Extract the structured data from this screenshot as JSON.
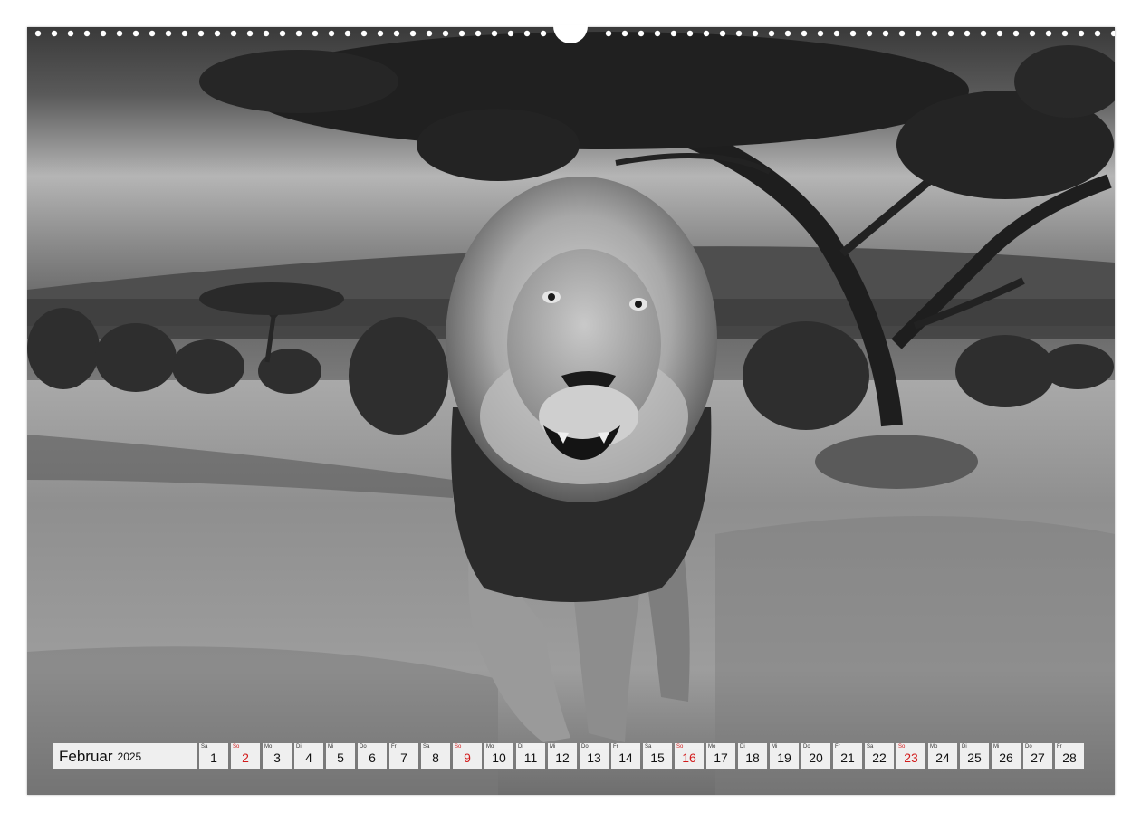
{
  "calendar": {
    "month": "Februar",
    "year": "2025",
    "days": [
      {
        "wd": "Sa",
        "num": "1",
        "sunday": false
      },
      {
        "wd": "So",
        "num": "2",
        "sunday": true
      },
      {
        "wd": "Mo",
        "num": "3",
        "sunday": false
      },
      {
        "wd": "Di",
        "num": "4",
        "sunday": false
      },
      {
        "wd": "Mi",
        "num": "5",
        "sunday": false
      },
      {
        "wd": "Do",
        "num": "6",
        "sunday": false
      },
      {
        "wd": "Fr",
        "num": "7",
        "sunday": false
      },
      {
        "wd": "Sa",
        "num": "8",
        "sunday": false
      },
      {
        "wd": "So",
        "num": "9",
        "sunday": true
      },
      {
        "wd": "Mo",
        "num": "10",
        "sunday": false
      },
      {
        "wd": "Di",
        "num": "11",
        "sunday": false
      },
      {
        "wd": "Mi",
        "num": "12",
        "sunday": false
      },
      {
        "wd": "Do",
        "num": "13",
        "sunday": false
      },
      {
        "wd": "Fr",
        "num": "14",
        "sunday": false
      },
      {
        "wd": "Sa",
        "num": "15",
        "sunday": false
      },
      {
        "wd": "So",
        "num": "16",
        "sunday": true
      },
      {
        "wd": "Mo",
        "num": "17",
        "sunday": false
      },
      {
        "wd": "Di",
        "num": "18",
        "sunday": false
      },
      {
        "wd": "Mi",
        "num": "19",
        "sunday": false
      },
      {
        "wd": "Do",
        "num": "20",
        "sunday": false
      },
      {
        "wd": "Fr",
        "num": "21",
        "sunday": false
      },
      {
        "wd": "Sa",
        "num": "22",
        "sunday": false
      },
      {
        "wd": "So",
        "num": "23",
        "sunday": true
      },
      {
        "wd": "Mo",
        "num": "24",
        "sunday": false
      },
      {
        "wd": "Di",
        "num": "25",
        "sunday": false
      },
      {
        "wd": "Mi",
        "num": "26",
        "sunday": false
      },
      {
        "wd": "Do",
        "num": "27",
        "sunday": false
      },
      {
        "wd": "Fr",
        "num": "28",
        "sunday": false
      }
    ]
  },
  "photo": {
    "subject": "lion-icon",
    "colors": {
      "sky_dark": "#3e3e3e",
      "sky_light": "#b9b9b9",
      "grass": "#9a9a9a",
      "sunday_red": "#d21a1a"
    }
  }
}
